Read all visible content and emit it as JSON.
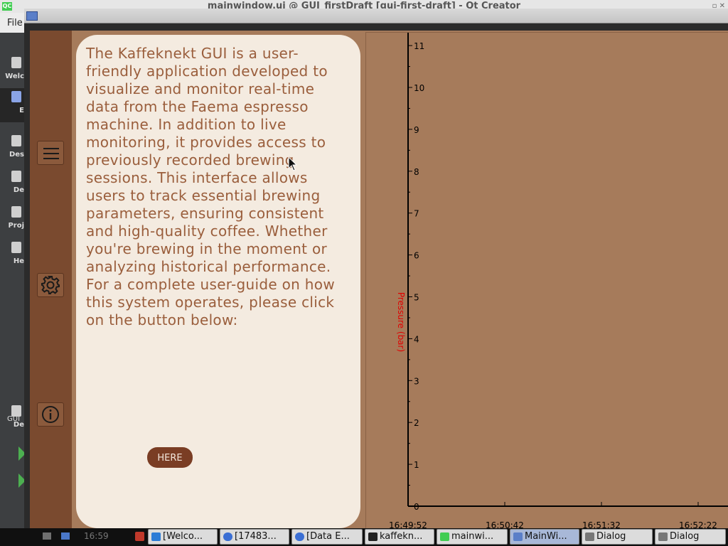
{
  "background_window": {
    "title": "mainwindow.ui @ GUI_firstDraft [gui-first-draft] - Qt Creator",
    "menu": "File",
    "modes": [
      "Welc",
      "E",
      "Des",
      "De",
      "Proj",
      "He"
    ],
    "kit_label": "GUI",
    "kit_sub": "De"
  },
  "app": {
    "info_text": "The Kaffeknekt GUI is a user-friendly application developed to visualize and monitor real-time data from the Faema espresso machine. In addition to live monitoring, it provides access to previously recorded brewing sessions. This interface allows users to track essential brewing parameters, ensuring consistent and high-quality coffee. Whether you're brewing in the moment or analyzing historical performance. For a complete user-guide on how this system operates, please click on the button below:",
    "here_button": "HERE",
    "sidebar_icons": [
      "hamburger-menu-icon",
      "gear-icon",
      "info-icon"
    ],
    "colors": {
      "sidebar": "#7a4a2f",
      "panel": "#f4ebe0",
      "text": "#9a5e3c",
      "chart_bg": "#a67b5b",
      "axis_label": "#e00000"
    }
  },
  "chart_data": {
    "type": "line",
    "ylabel": "Pressure (bar)",
    "xlabel": "",
    "x_ticks": [
      "16:49:52",
      "16:50:42",
      "16:51:32",
      "16:52:22"
    ],
    "y_ticks": [
      0,
      1,
      2,
      3,
      4,
      5,
      6,
      7,
      8,
      9,
      10,
      11
    ],
    "ylim": [
      0,
      11.5
    ],
    "series": []
  },
  "taskbar": {
    "clock": "16:59",
    "tasks": [
      {
        "label": "[Welco...",
        "icon": "vscode-icon"
      },
      {
        "label": "[17483...",
        "icon": "browser-icon"
      },
      {
        "label": "[Data E...",
        "icon": "browser-icon"
      },
      {
        "label": "kaffekn...",
        "icon": "terminal-icon"
      },
      {
        "label": "mainwi...",
        "icon": "qt-icon"
      },
      {
        "label": "MainWi...",
        "icon": "window-icon"
      },
      {
        "label": "Dialog",
        "icon": "dialog-icon"
      },
      {
        "label": "Dialog",
        "icon": "dialog-icon"
      }
    ]
  }
}
